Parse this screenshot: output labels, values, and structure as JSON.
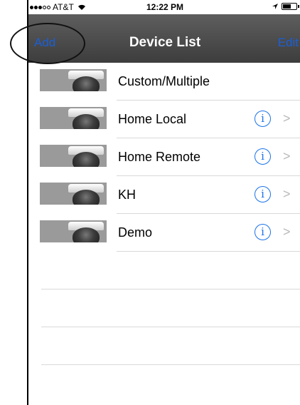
{
  "status_bar": {
    "carrier": "AT&T",
    "time": "12:22 PM",
    "signal_dots_filled": 3,
    "signal_dots_total": 5,
    "battery_level": 0.6
  },
  "nav_bar": {
    "left_label": "Add",
    "title": "Device List",
    "right_label": "Edit"
  },
  "devices": [
    {
      "label": "Custom/Multiple",
      "has_detail": false
    },
    {
      "label": "Home Local",
      "has_detail": true
    },
    {
      "label": "Home Remote",
      "has_detail": true
    },
    {
      "label": "KH",
      "has_detail": true
    },
    {
      "label": "Demo",
      "has_detail": true
    }
  ],
  "icons": {
    "info": "i",
    "chevron": ">"
  },
  "colors": {
    "nav_background": "#4a4a4a",
    "accent": "#1a73e8",
    "nav_button": "#1a5fd6"
  }
}
